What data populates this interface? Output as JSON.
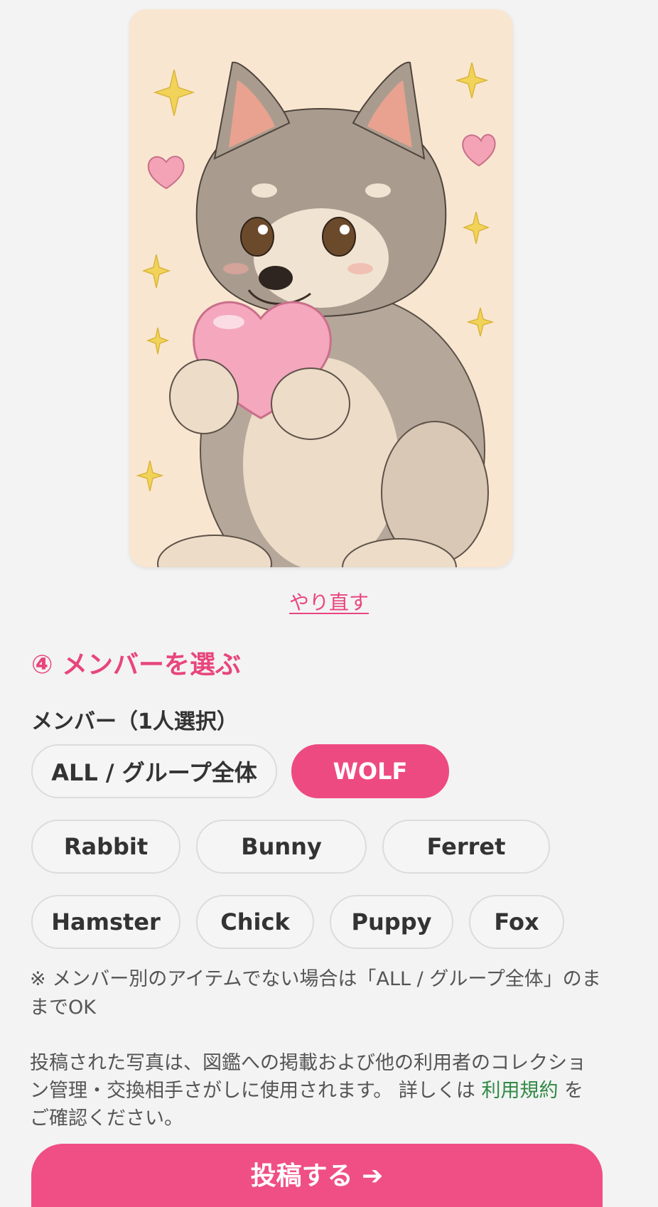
{
  "redo_label": "やり直す",
  "section": {
    "title": "④ メンバーを選ぶ",
    "field_label": "メンバー（1人選択）"
  },
  "members": {
    "selected": "WOLF",
    "options": [
      "ALL / グループ全体",
      "WOLF",
      "Rabbit",
      "Bunny",
      "Ferret",
      "Hamster",
      "Chick",
      "Puppy",
      "Fox"
    ]
  },
  "note": "※ メンバー別のアイテムでない場合は「ALL / グループ全体」のままでOK",
  "terms": {
    "text_before": "投稿された写真は、図鑑への掲載および他の利用者のコレクション管理・交換相手さがしに使用されます。 詳しくは ",
    "link": "利用規約",
    "text_after": " をご確認ください。"
  },
  "submit_label": "投稿する ➔",
  "colors": {
    "accent": "#ee4a82",
    "link": "#2f8a43",
    "background": "#f3f3f4"
  },
  "image": {
    "description_icon": "wolf-pup-holding-heart-illustration"
  }
}
